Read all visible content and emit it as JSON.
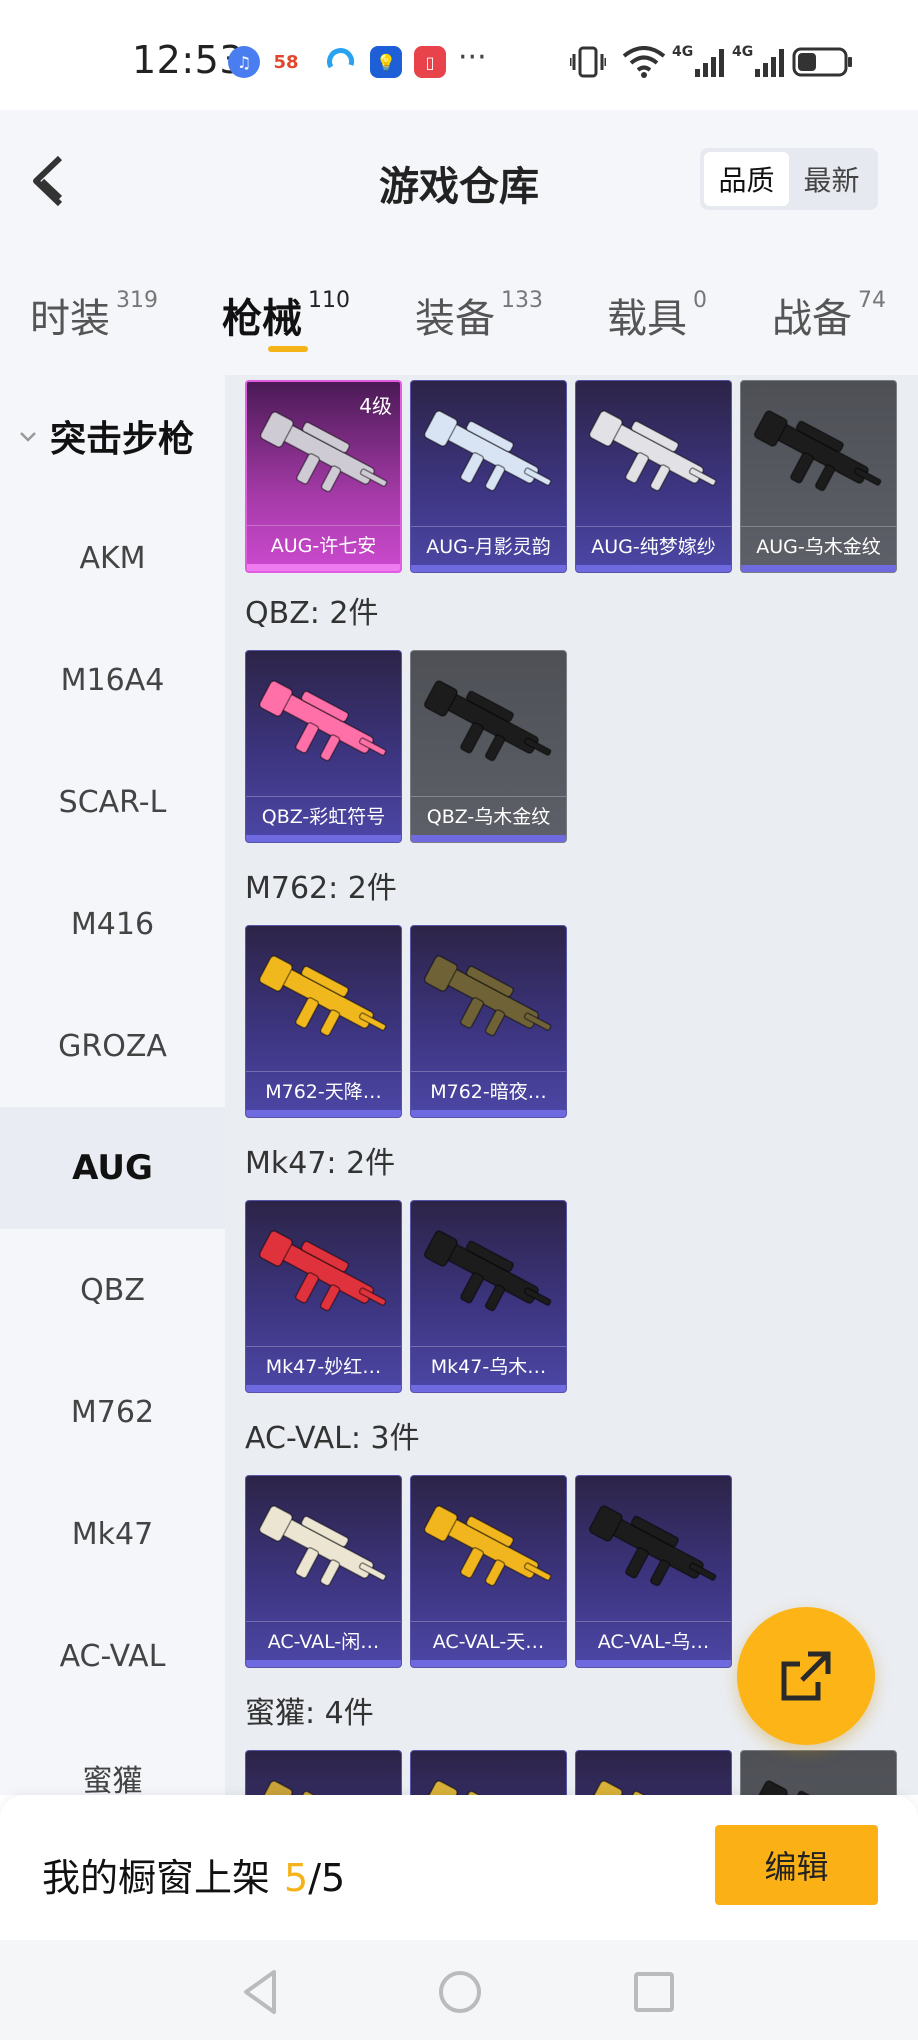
{
  "status_bar": {
    "time": "12:53",
    "apps": [
      "music-app-icon",
      "58-app-icon",
      "browser-app-icon",
      "tips-app-icon",
      "book-app-icon"
    ],
    "app_58_label": "58",
    "more": "···",
    "network_1": "4G",
    "network_2": "4G",
    "battery_level": 0.4
  },
  "header": {
    "title": "游戏仓库",
    "sort_options": [
      "品质",
      "最新"
    ],
    "sort_selected": "品质"
  },
  "category_tabs": [
    {
      "label": "时装",
      "count": "319"
    },
    {
      "label": "枪械",
      "count": "110",
      "active": true
    },
    {
      "label": "装备",
      "count": "133"
    },
    {
      "label": "载具",
      "count": "0"
    },
    {
      "label": "战备",
      "count": "74"
    }
  ],
  "sidebar": {
    "group_title": "突击步枪",
    "items": [
      "AKM",
      "M16A4",
      "SCAR-L",
      "M416",
      "GROZA",
      "AUG",
      "QBZ",
      "M762",
      "Mk47",
      "AC-VAL",
      "蜜獾"
    ],
    "selected": "AUG"
  },
  "sections": [
    {
      "title": "",
      "items": [
        {
          "name": "AUG-许七安",
          "level": "4级",
          "style": "pink",
          "gun_color": "#cfcbd4"
        },
        {
          "name": "AUG-月影灵韵",
          "style": "purple",
          "gun_color": "#d8e4f4"
        },
        {
          "name": "AUG-纯梦嫁纱",
          "style": "purple",
          "gun_color": "#e1e1e6"
        },
        {
          "name": "AUG-乌木金纹",
          "style": "gray",
          "gun_color": "#1c1c1c"
        }
      ]
    },
    {
      "title": "QBZ: 2件",
      "items": [
        {
          "name": "QBZ-彩虹符号",
          "style": "purple",
          "gun_color": "#ff6fa8"
        },
        {
          "name": "QBZ-乌木金纹",
          "style": "gray",
          "gun_color": "#1c1c1c"
        }
      ]
    },
    {
      "title": "M762: 2件",
      "items": [
        {
          "name": "M762-天降…",
          "style": "purple",
          "gun_color": "#f1b81e"
        },
        {
          "name": "M762-暗夜…",
          "style": "purple",
          "gun_color": "#6e6236"
        }
      ]
    },
    {
      "title": "Mk47: 2件",
      "items": [
        {
          "name": "Mk47-妙红…",
          "style": "purple",
          "gun_color": "#e0323c"
        },
        {
          "name": "Mk47-乌木…",
          "style": "purple",
          "gun_color": "#1c1c1c"
        }
      ]
    },
    {
      "title": "AC-VAL: 3件",
      "items": [
        {
          "name": "AC-VAL-闲…",
          "style": "purple",
          "gun_color": "#ebe5d2"
        },
        {
          "name": "AC-VAL-天…",
          "style": "purple",
          "gun_color": "#f1b51e"
        },
        {
          "name": "AC-VAL-乌…",
          "style": "purple",
          "gun_color": "#1c1c1c"
        }
      ]
    },
    {
      "title": "蜜獾: 4件",
      "items": [
        {
          "name": "",
          "style": "purple",
          "gun_color": "#c9a23a"
        },
        {
          "name": "",
          "style": "purple",
          "gun_color": "#d9b13a"
        },
        {
          "name": "",
          "style": "purple",
          "gun_color": "#d9b13a"
        },
        {
          "name": "",
          "style": "gray",
          "gun_color": "#1c1c1c"
        }
      ]
    }
  ],
  "fab": {
    "icon": "share-external-icon",
    "color": "#fcb416"
  },
  "bottom_bar": {
    "label": "我的橱窗上架",
    "current": "5",
    "total": "/5",
    "edit_label": "编辑",
    "accent": "#f5b31a"
  },
  "nav_bar": {
    "icons": [
      "back-triangle-icon",
      "home-circle-icon",
      "recents-square-icon"
    ]
  }
}
